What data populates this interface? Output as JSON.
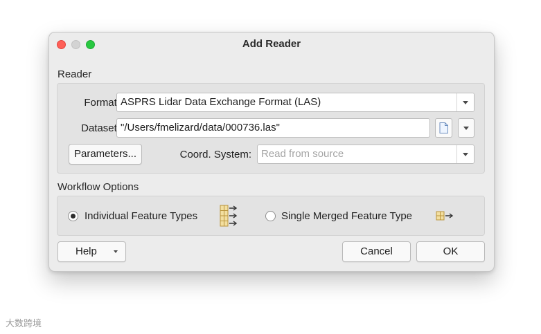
{
  "window": {
    "title": "Add Reader"
  },
  "reader": {
    "section_label": "Reader",
    "format_label": "Format:",
    "format_value": "ASPRS Lidar Data Exchange Format (LAS)",
    "dataset_label": "Dataset:",
    "dataset_value": "\"/Users/fmelizard/data/000736.las\"",
    "parameters_label": "Parameters...",
    "coord_label": "Coord. System:",
    "coord_placeholder": "Read from source"
  },
  "workflow": {
    "section_label": "Workflow Options",
    "option_individual": "Individual Feature Types",
    "option_merged": "Single Merged Feature Type",
    "selected": "individual"
  },
  "footer": {
    "help_label": "Help",
    "cancel_label": "Cancel",
    "ok_label": "OK"
  },
  "watermark": {
    "text": "大数跨境"
  },
  "colors": {
    "close": "#fe5f57",
    "minimize": "#d3d3d3",
    "maximize": "#28c840",
    "feature_icon": "#c8a44a"
  },
  "icons": [
    "document-icon",
    "feature-types-icon",
    "merged-feature-icon",
    "chevron-down-icon"
  ]
}
